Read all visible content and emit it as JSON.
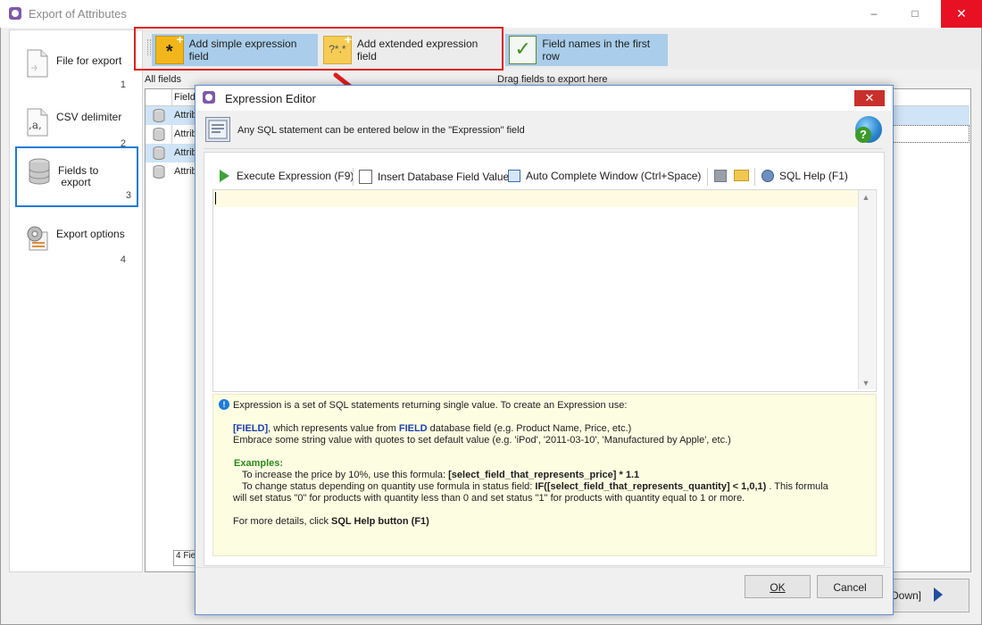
{
  "window": {
    "title": "Export of Attributes",
    "minimize": "–",
    "maximize": "□",
    "close": "✕"
  },
  "nav": {
    "items": [
      {
        "label": "File for export",
        "num": "1",
        "icon": "file-icon"
      },
      {
        "label": "CSV delimiter",
        "num": "2",
        "icon": "csv-icon"
      },
      {
        "label": "Fields to\n export",
        "num": "3",
        "icon": "database-icon"
      },
      {
        "label": "Export options",
        "num": "4",
        "icon": "settings-icon"
      }
    ]
  },
  "toolbar": {
    "simple_label": "Add simple expression field",
    "extended_label": "Add extended expression field",
    "fieldnames_label": "Field names in the first row"
  },
  "content": {
    "all_fields_label": "All fields",
    "drag_label": "Drag fields to export here",
    "grid_header": "Field",
    "rows": [
      "Attrib",
      "Attrib",
      "Attrib",
      "Attrib"
    ],
    "footer_count": "4 Fie",
    "down_label": "Down]"
  },
  "dialog": {
    "title": "Expression Editor",
    "close": "✕",
    "info_text": "Any SQL statement can be entered below in the \"Expression\" field",
    "help_mark": "?",
    "toolbar": {
      "execute": "Execute Expression (F9)",
      "insert_field": "Insert Database Field Value",
      "autocomplete": "Auto Complete Window (Ctrl+Space)",
      "sql_help": "SQL Help (F1)"
    },
    "help": {
      "line1": "Expression is a set of SQL statements returning single value. To create an Expression use:",
      "field_token": "[FIELD]",
      "line2_mid": ", which represents value from ",
      "field_word": "FIELD",
      "line2_end": " database field (e.g. Product Name, Price, etc.)",
      "line3": "Embrace some string value with quotes to set default value (e.g. 'iPod', '2011-03-10', 'Manufactured by Apple', etc.)",
      "examples_title": "Examples:",
      "ex1_text": "To increase the price by 10%, use this formula: ",
      "ex1_formula": "[select_field_that_represents_price] * 1.1",
      "ex2_text": "To change status depending on quantity use formula in status field: ",
      "ex2_formula": "IF([select_field_that_represents_quantity] < 1,0,1)",
      "ex2_end": " . This formula",
      "ex2_cont": "will set status \"0\" for products with quantity less than 0 and set status \"1\" for products with quantity equal to 1 or more.",
      "more_text": "For more details, click ",
      "more_button": "SQL Help button (F1)"
    },
    "ok": "OK",
    "cancel": "Cancel"
  },
  "colors": {
    "accent": "#1f7ad6",
    "annotation": "#e01e1e",
    "selected_toolbar": "#a9cdea",
    "help_bg": "#fdfde2"
  }
}
